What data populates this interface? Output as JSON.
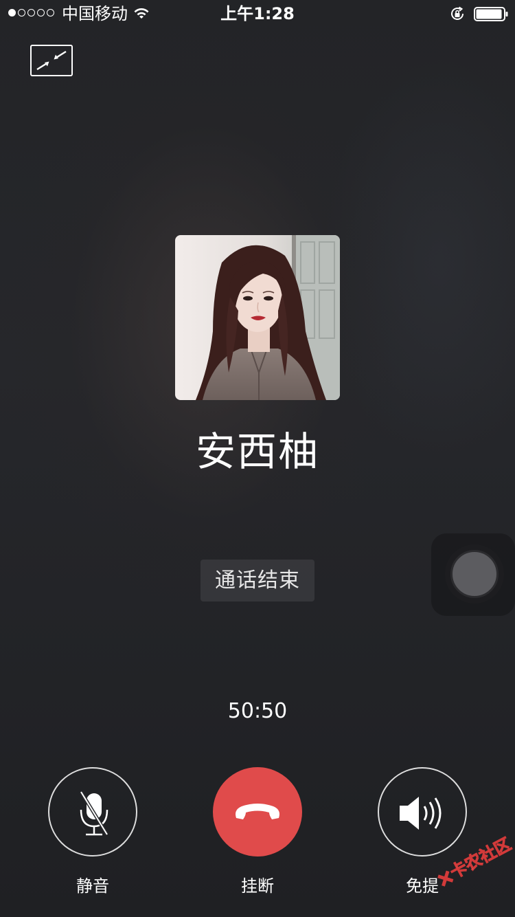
{
  "status_bar": {
    "signal_strength": 1,
    "signal_dots_total": 5,
    "carrier": "中国移动",
    "time": "上午1:28",
    "battery_level": 0.95
  },
  "call": {
    "contact_name": "安西柚",
    "status": "通话结束",
    "duration": "50:50"
  },
  "controls": {
    "mute_label": "静音",
    "hangup_label": "挂断",
    "speaker_label": "免提"
  },
  "watermark": {
    "text": "卡农社区"
  },
  "colors": {
    "hangup": "#e04b4b",
    "background": "#232427",
    "text": "#ffffff"
  },
  "icons": {
    "minimize": "minimize-arrows-icon",
    "mute": "microphone-off-icon",
    "hangup": "phone-hangup-icon",
    "speaker": "speaker-volume-icon"
  }
}
